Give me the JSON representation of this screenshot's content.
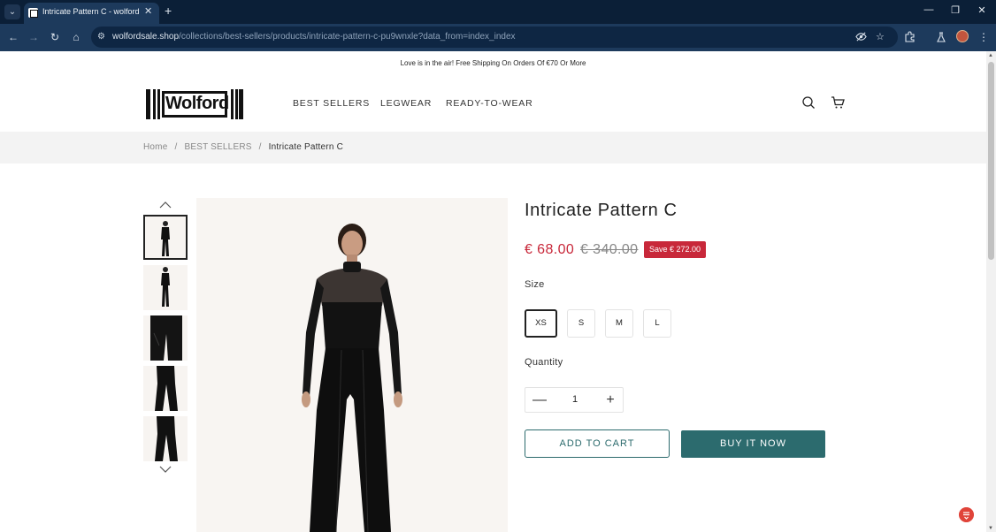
{
  "browser": {
    "tab_title": "Intricate Pattern C - wolford",
    "url_domain": "wolfordsale.shop",
    "url_path": "/collections/best-sellers/products/intricate-pattern-c-pu9wnxle?data_from=index_index",
    "tab_close": "✕",
    "new_tab": "+",
    "window": {
      "minimize": "—",
      "restore": "❐",
      "close": "✕"
    }
  },
  "announcement": "Love is in the air! Free Shipping On Orders Of €70 Or More",
  "logo_text": "Wolford",
  "nav": [
    "BEST SELLERS",
    "LEGWEAR",
    "READY-TO-WEAR"
  ],
  "breadcrumb": {
    "home": "Home",
    "collection": "BEST SELLERS",
    "current": "Intricate Pattern C",
    "separator": "/"
  },
  "product": {
    "title": "Intricate Pattern C",
    "price": "€ 68.00",
    "compare_price": "€ 340.00",
    "save_badge": "Save € 272.00",
    "size_label": "Size",
    "sizes": [
      "XS",
      "S",
      "M",
      "L"
    ],
    "selected_size": "XS",
    "quantity_label": "Quantity",
    "quantity": "1",
    "qty_minus": "—",
    "qty_plus": "+",
    "add_to_cart": "ADD TO CART",
    "buy_now": "BUY IT NOW"
  },
  "colors": {
    "sale_red": "#c8283a",
    "teal": "#2c6b6e",
    "chrome_dark": "#0b1f37",
    "chrome_toolbar": "#1d3a5c"
  }
}
